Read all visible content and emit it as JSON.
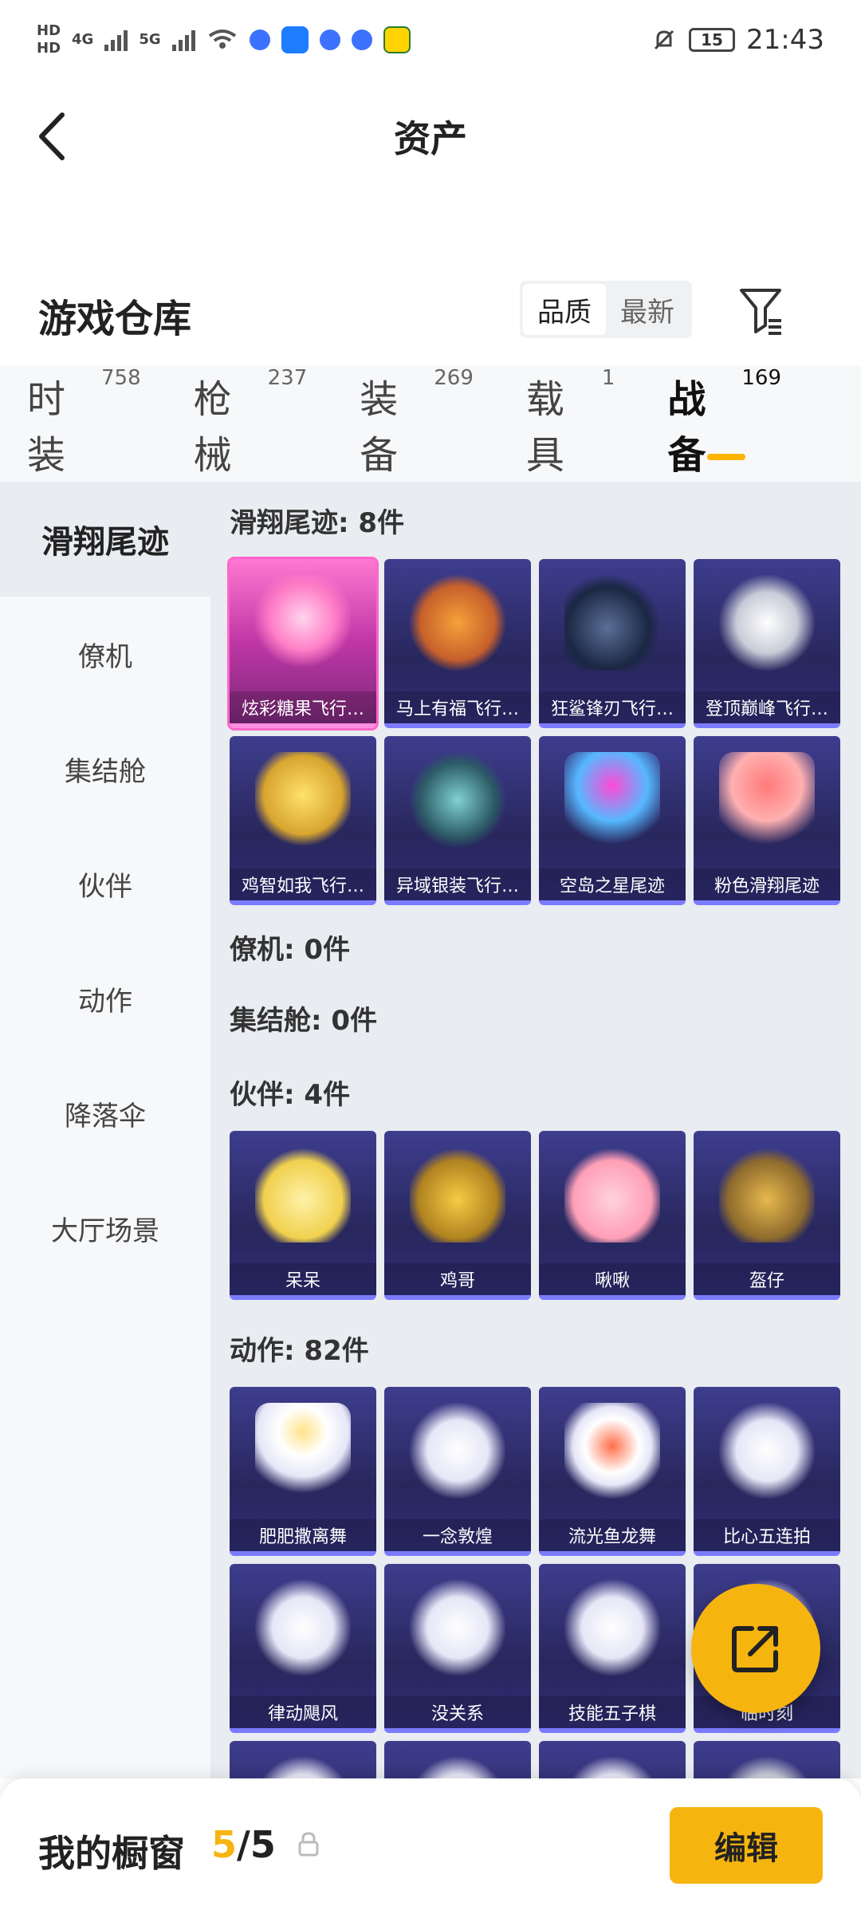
{
  "status_bar": {
    "time": "21:43",
    "battery": "15",
    "network_1": "4G",
    "network_2": "5G",
    "hd_1": "HD",
    "hd_2": "HD",
    "icons": [
      "signal-icon",
      "wifi-icon",
      "app-icon",
      "app-icon",
      "app-icon",
      "app-icon",
      "app-icon",
      "bell-off-icon",
      "battery-icon"
    ]
  },
  "title_bar": {
    "title": "资产",
    "back_icon": "back-icon"
  },
  "header": {
    "title": "游戏仓库",
    "sort_options": [
      "品质",
      "最新"
    ],
    "selected_sort": "品质",
    "filter_icon": "filter-icon"
  },
  "tabs": [
    {
      "label": "时装",
      "count": "758"
    },
    {
      "label": "枪械",
      "count": "237"
    },
    {
      "label": "装备",
      "count": "269"
    },
    {
      "label": "载具",
      "count": "1"
    },
    {
      "label": "战备",
      "count": "169",
      "active": true
    }
  ],
  "sidebar": {
    "items": [
      {
        "label": "滑翔尾迹",
        "active": true
      },
      {
        "label": "僚机"
      },
      {
        "label": "集结舱"
      },
      {
        "label": "伙伴"
      },
      {
        "label": "动作"
      },
      {
        "label": "降落伞"
      },
      {
        "label": "大厅场景"
      }
    ]
  },
  "sections": [
    {
      "title": "滑翔尾迹: 8件",
      "items": [
        "炫彩糖果飞行…",
        "马上有福飞行…",
        "狂鲨锋刃飞行…",
        "登顶巅峰飞行…",
        "鸡智如我飞行…",
        "异域银装飞行…",
        "空岛之星尾迹",
        "粉色滑翔尾迹"
      ]
    },
    {
      "title": "僚机: 0件",
      "items": []
    },
    {
      "title": "集结舱: 0件",
      "items": []
    },
    {
      "title": "伙伴: 4件",
      "items": [
        "呆呆",
        "鸡哥",
        "啾啾",
        "盔仔"
      ]
    },
    {
      "title": "动作: 82件",
      "items": [
        "肥肥撒离舞",
        "一念敦煌",
        "流光鱼龙舞",
        "比心五连拍",
        "律动飓风",
        "没关系",
        "技能五子棋",
        "临时刻"
      ]
    }
  ],
  "bottom_bar": {
    "label": "我的橱窗",
    "count_current": "5",
    "count_total": "/5",
    "lock_icon": "lock-icon",
    "edit_label": "编辑"
  },
  "colors": {
    "accent": "#f6b40f",
    "card_pink": "#ff66c9",
    "card_blue": "#3e3d8e"
  }
}
